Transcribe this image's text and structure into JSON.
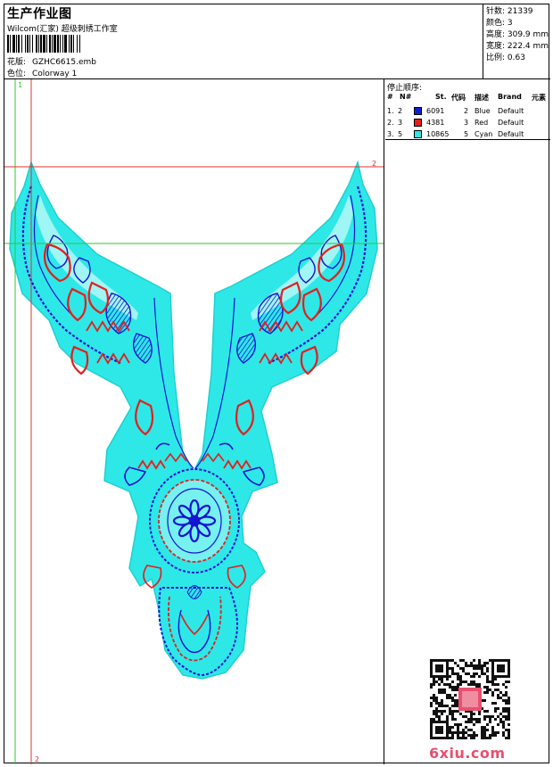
{
  "header": {
    "title": "生产作业图",
    "company": "Wilcom(汇家) 超级刺绣工作室",
    "design_label": "花版:",
    "design_value": "GZHC6615.emb",
    "colorway_label": "色位:",
    "colorway_value": "Colorway 1"
  },
  "info": {
    "stitches": "针数: 21339",
    "colors": "颜色: 3",
    "height": "高度: 309.9 mm",
    "width": "宽度: 222.4 mm",
    "scale": "比例: 0.63"
  },
  "guides": {
    "v1_label": "1",
    "v2_label": "2",
    "h1_label": "2"
  },
  "stop_sequence": {
    "title": "停止顺序:",
    "headers": [
      "#",
      "N#",
      "St.",
      "代码",
      "描述",
      "Brand",
      "元素"
    ],
    "rows": [
      {
        "seq": "1.",
        "needle": "2",
        "color": "#0a1ed8",
        "stitches": "6091",
        "code": "2",
        "desc": "Blue",
        "brand": "Default"
      },
      {
        "seq": "2.",
        "needle": "3",
        "color": "#e81c1c",
        "stitches": "4381",
        "code": "3",
        "desc": "Red",
        "brand": "Default"
      },
      {
        "seq": "3.",
        "needle": "5",
        "color": "#2ee6e6",
        "stitches": "10865",
        "code": "5",
        "desc": "Cyan",
        "brand": "Default"
      }
    ]
  },
  "colors": {
    "blue": "#1414d2",
    "red": "#e41e1e",
    "cyan": "#2ee8e8",
    "guide_red": "#e03030",
    "guide_green": "#2ec82e"
  },
  "watermark": "6xiu.com"
}
